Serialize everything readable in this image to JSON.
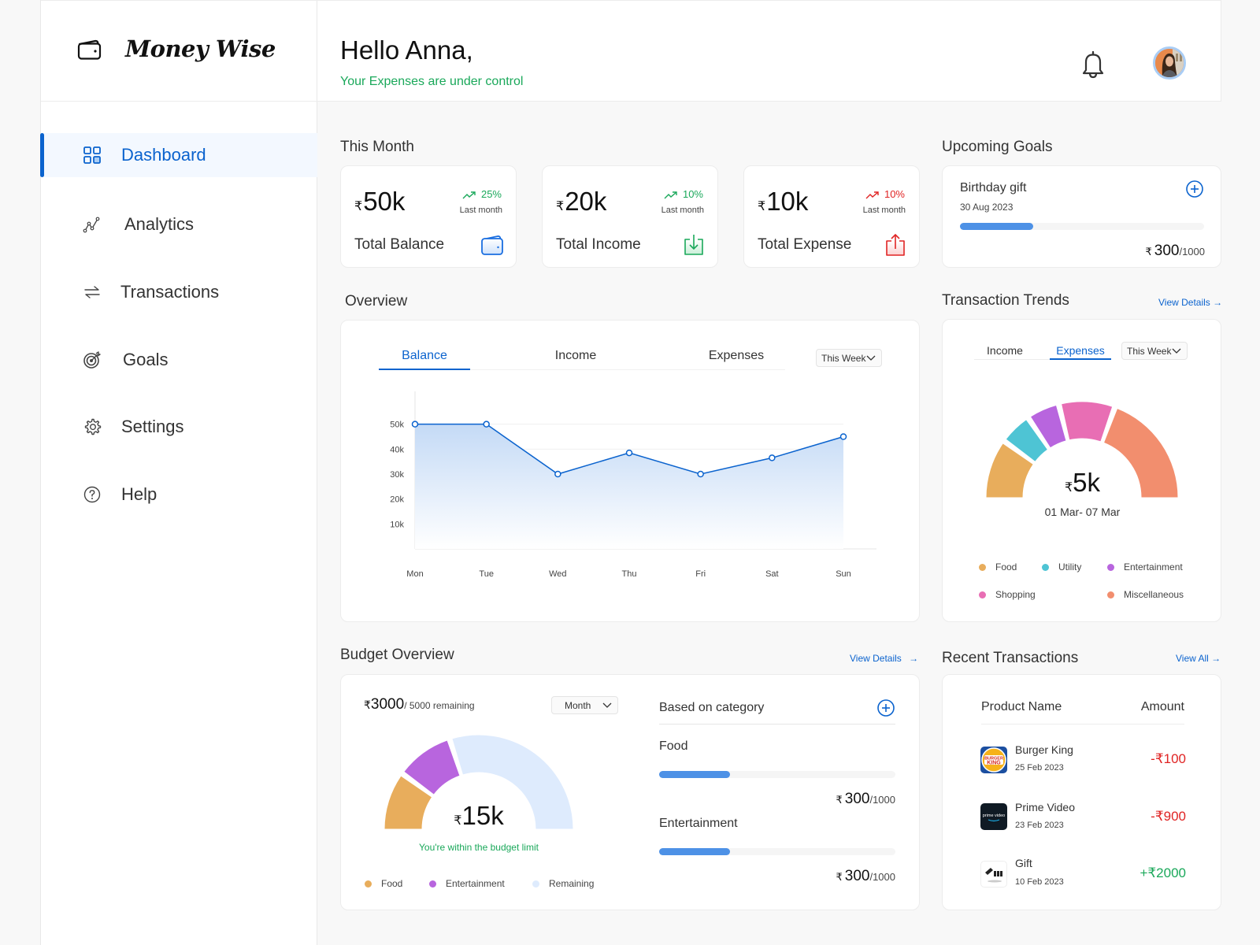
{
  "app": {
    "name": "Money Wise"
  },
  "sidebar": {
    "items": [
      {
        "label": "Dashboard",
        "icon": "dashboard-grid-icon",
        "active": true
      },
      {
        "label": "Analytics",
        "icon": "analytics-icon",
        "active": false
      },
      {
        "label": "Transactions",
        "icon": "transfer-arrows-icon",
        "active": false
      },
      {
        "label": "Goals",
        "icon": "target-icon",
        "active": false
      },
      {
        "label": "Settings",
        "icon": "gear-icon",
        "active": false
      },
      {
        "label": "Help",
        "icon": "help-circle-icon",
        "active": false
      }
    ]
  },
  "header": {
    "greeting": "Hello Anna,",
    "subtitle": "Your Expenses are under control",
    "bell_icon": "bell-icon",
    "avatar": "user-avatar"
  },
  "this_month": {
    "title": "This Month",
    "cards": [
      {
        "currency": "₹",
        "value": "50k",
        "change": "25%",
        "change_dir": "up",
        "change_color": "#1aa85a",
        "sub": "Last month",
        "label": "Total Balance",
        "icon": "wallet-icon"
      },
      {
        "currency": "₹",
        "value": "20k",
        "change": "10%",
        "change_dir": "up",
        "change_color": "#1aa85a",
        "sub": "Last month",
        "label": "Total Income",
        "icon": "download-icon"
      },
      {
        "currency": "₹",
        "value": "10k",
        "change": "10%",
        "change_dir": "up",
        "change_color": "#e02424",
        "sub": "Last month",
        "label": "Total Expense",
        "icon": "upload-icon"
      }
    ]
  },
  "goals": {
    "title": "Upcoming Goals",
    "items": [
      {
        "name": "Birthday gift",
        "date": "30 Aug 2023",
        "currency": "₹",
        "saved": "300",
        "target": "/1000",
        "progress": 0.3
      }
    ]
  },
  "overview": {
    "title": "Overview",
    "tabs": [
      "Balance",
      "Income",
      "Expenses"
    ],
    "active_tab": 0,
    "period": "This Week"
  },
  "chart_data": {
    "type": "area",
    "title": "Overview - Balance",
    "categories": [
      "Mon",
      "Tue",
      "Wed",
      "Thu",
      "Fri",
      "Sat",
      "Sun"
    ],
    "series": [
      {
        "name": "Balance",
        "values": [
          50000,
          50000,
          30000,
          38500,
          30000,
          36500,
          45000
        ],
        "color": "#0b63ce"
      }
    ],
    "yticks": [
      10000,
      20000,
      30000,
      40000,
      50000
    ],
    "ytick_labels": [
      "10k",
      "20k",
      "30k",
      "40k",
      "50k"
    ],
    "ylim": [
      0,
      60000
    ],
    "grid": true,
    "xlabel": "",
    "ylabel": ""
  },
  "trends": {
    "title": "Transaction Trends",
    "view_details": "View Details",
    "tabs": [
      "Income",
      "Expenses"
    ],
    "active_tab": 1,
    "period": "This Week",
    "total_currency": "₹",
    "total": "5k",
    "range": "01 Mar- 07 Mar",
    "segments": [
      {
        "name": "Food",
        "share": 0.18,
        "color": "#e8ad5c"
      },
      {
        "name": "Utility",
        "share": 0.1,
        "color": "#4ec4d4"
      },
      {
        "name": "Entertainment",
        "share": 0.1,
        "color": "#b865de"
      },
      {
        "name": "Shopping",
        "share": 0.17,
        "color": "#e86eb4"
      },
      {
        "name": "Miscellaneous",
        "share": 0.35,
        "color": "#f28e6e"
      }
    ]
  },
  "budget": {
    "title": "Budget Overview",
    "view_details": "View Details",
    "remaining_currency": "₹",
    "remaining": "3000",
    "remaining_suffix": "/ 5000 remaining",
    "period": "Month",
    "total_currency": "₹",
    "total": "15k",
    "status": "You're within the budget limit",
    "segments": [
      {
        "name": "Food",
        "share": 0.2,
        "color": "#e8ad5c"
      },
      {
        "name": "Entertainment",
        "share": 0.2,
        "color": "#b865de"
      },
      {
        "name": "Remaining",
        "share": 0.6,
        "color": "#deebfd"
      }
    ],
    "category_title": "Based on category",
    "categories": [
      {
        "name": "Food",
        "currency": "₹",
        "spent": "300",
        "limit": "/1000",
        "progress": 0.3
      },
      {
        "name": "Entertainment",
        "currency": "₹",
        "spent": "300",
        "limit": "/1000",
        "progress": 0.3
      }
    ]
  },
  "recent": {
    "title": "Recent Transactions",
    "view_all": "View All",
    "columns": [
      "Product Name",
      "Amount"
    ],
    "rows": [
      {
        "name": "Burger King",
        "date": "25 Feb 2023",
        "amount": "-₹100",
        "type": "debit",
        "logo": "burger-king-logo"
      },
      {
        "name": "Prime Video",
        "date": "23 Feb 2023",
        "amount": "-₹900",
        "type": "debit",
        "logo": "prime-video-logo"
      },
      {
        "name": "Gift",
        "date": "10 Feb 2023",
        "amount": "+₹2000",
        "type": "credit",
        "logo": "gift-logo"
      }
    ]
  }
}
